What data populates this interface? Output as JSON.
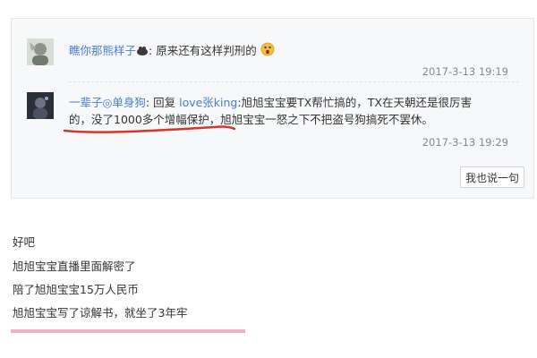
{
  "comments": [
    {
      "user": "瞧你那熊样子",
      "body": "原来还有这样判刑的",
      "time": "2017-3-13 19:19"
    },
    {
      "user": "一辈子◎单身狗",
      "reply_prefix": ": 回复 ",
      "reply_to": "love张king",
      "body_line1": ":旭旭宝宝要TX帮忙搞的，TX在天朝还是很厉害",
      "body_line2": "的，没了1000多个增幅保护，旭旭宝宝一怒之下不把盗号狗搞死不罢休。",
      "time": "2017-3-13 19:29"
    }
  ],
  "reply_button_label": "我也说一句",
  "text_lines": [
    "好吧",
    "旭旭宝宝直播里面解密了",
    "陪了旭旭宝宝15万人民币",
    "旭旭宝宝写了谅解书，就坐了3年牢"
  ],
  "colors": {
    "username": "#4a7ec6",
    "underline": "#d8342c",
    "highlight": "#e6a0b4"
  }
}
